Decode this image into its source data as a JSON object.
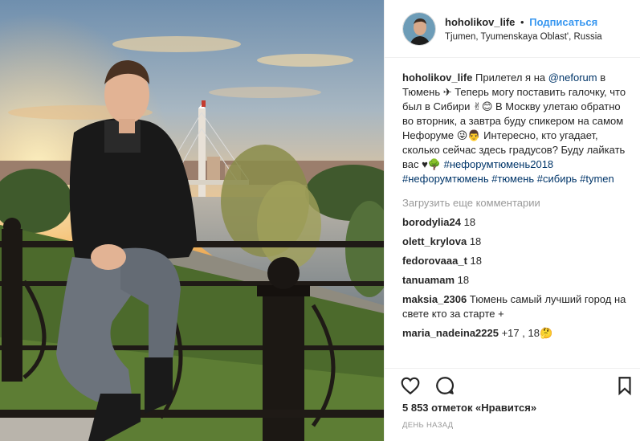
{
  "header": {
    "username": "hoholikov_life",
    "dot": "•",
    "follow_label": "Подписаться",
    "location": "Tjumen, Tyumenskaya Oblast', Russia"
  },
  "caption": {
    "username": "hoholikov_life",
    "text1": " Прилетел я на ",
    "mention": "@neforum",
    "text2": " в Тюмень ✈ Теперь могу поставить галочку, что был в Сибири ✌😊 В Москву улетаю обратно во вторник, а завтра буду спикером на самом Нефоруме 😜👨 Интересно, кто угадает, сколько сейчас здесь градусов? Буду лайкать вас ♥🌳 ",
    "tags": [
      "#нефорумтюмень2018",
      "#нефорумтюмень",
      "#тюмень",
      "#сибирь",
      "#tymen"
    ]
  },
  "load_more": "Загрузить еще комментарии",
  "comments": [
    {
      "user": "borodylia24",
      "text": "18"
    },
    {
      "user": "olett_krylova",
      "text": "18"
    },
    {
      "user": "fedorovaaa_t",
      "text": "18"
    },
    {
      "user": "tanuamam",
      "text": "18"
    },
    {
      "user": "maksia_2306",
      "text": "Тюмень самый лучший город на свете кто за старте +"
    },
    {
      "user": "maria_nadeina2225",
      "text": "+17 ,  18🤔"
    }
  ],
  "icons": {
    "like": "heart-icon",
    "comment": "comment-icon",
    "save": "bookmark-icon"
  },
  "likes": "5 853 отметок «Нравится»",
  "time": "ДЕНЬ НАЗАД"
}
